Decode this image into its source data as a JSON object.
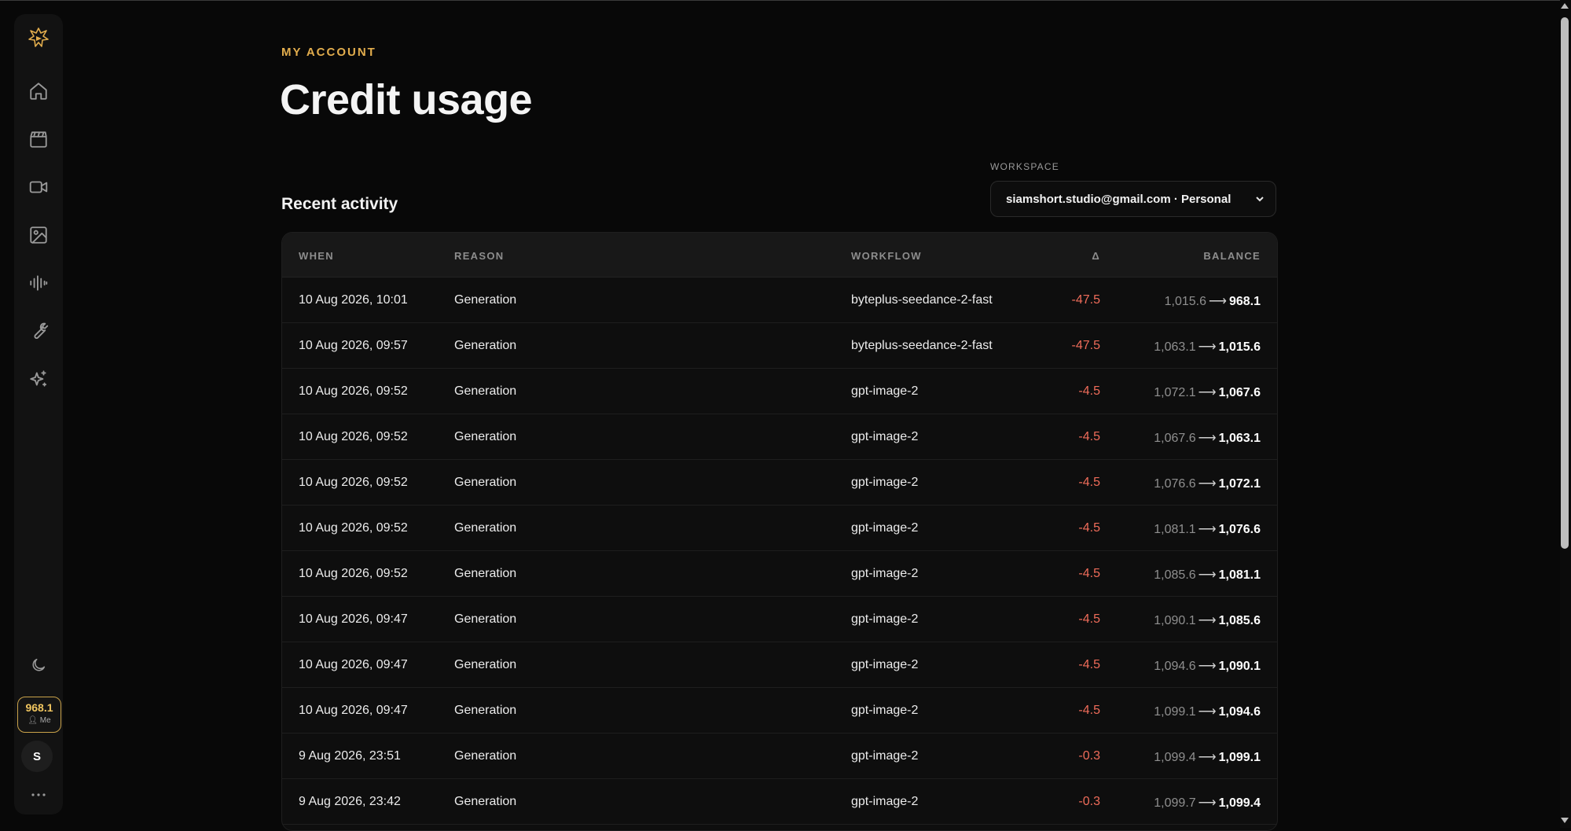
{
  "sidebar": {
    "items": [
      {
        "icon": "home-icon"
      },
      {
        "icon": "clapperboard-icon"
      },
      {
        "icon": "video-camera-icon"
      },
      {
        "icon": "image-icon"
      },
      {
        "icon": "audio-waveform-icon"
      },
      {
        "icon": "wrench-icon"
      },
      {
        "icon": "sparkles-icon"
      }
    ],
    "theme_icon": "moon-icon",
    "credits": {
      "value": "968.1",
      "owner": "Me"
    },
    "avatar_initial": "S",
    "more_icon": "more-dots-icon"
  },
  "header": {
    "eyebrow": "MY ACCOUNT",
    "title": "Credit usage"
  },
  "section": {
    "title": "Recent activity"
  },
  "workspace": {
    "label": "WORKSPACE",
    "selected": "siamshort.studio@gmail.com · Personal"
  },
  "table": {
    "columns": {
      "when": "WHEN",
      "reason": "REASON",
      "workflow": "WORKFLOW",
      "delta": "Δ",
      "balance": "BALANCE"
    },
    "rows": [
      {
        "when": "10 Aug 2026, 10:01",
        "reason": "Generation",
        "workflow": "byteplus-seedance-2-fast",
        "delta": "-47.5",
        "from": "1,015.6",
        "to": "968.1"
      },
      {
        "when": "10 Aug 2026, 09:57",
        "reason": "Generation",
        "workflow": "byteplus-seedance-2-fast",
        "delta": "-47.5",
        "from": "1,063.1",
        "to": "1,015.6"
      },
      {
        "when": "10 Aug 2026, 09:52",
        "reason": "Generation",
        "workflow": "gpt-image-2",
        "delta": "-4.5",
        "from": "1,072.1",
        "to": "1,067.6"
      },
      {
        "when": "10 Aug 2026, 09:52",
        "reason": "Generation",
        "workflow": "gpt-image-2",
        "delta": "-4.5",
        "from": "1,067.6",
        "to": "1,063.1"
      },
      {
        "when": "10 Aug 2026, 09:52",
        "reason": "Generation",
        "workflow": "gpt-image-2",
        "delta": "-4.5",
        "from": "1,076.6",
        "to": "1,072.1"
      },
      {
        "when": "10 Aug 2026, 09:52",
        "reason": "Generation",
        "workflow": "gpt-image-2",
        "delta": "-4.5",
        "from": "1,081.1",
        "to": "1,076.6"
      },
      {
        "when": "10 Aug 2026, 09:52",
        "reason": "Generation",
        "workflow": "gpt-image-2",
        "delta": "-4.5",
        "from": "1,085.6",
        "to": "1,081.1"
      },
      {
        "when": "10 Aug 2026, 09:47",
        "reason": "Generation",
        "workflow": "gpt-image-2",
        "delta": "-4.5",
        "from": "1,090.1",
        "to": "1,085.6"
      },
      {
        "when": "10 Aug 2026, 09:47",
        "reason": "Generation",
        "workflow": "gpt-image-2",
        "delta": "-4.5",
        "from": "1,094.6",
        "to": "1,090.1"
      },
      {
        "when": "10 Aug 2026, 09:47",
        "reason": "Generation",
        "workflow": "gpt-image-2",
        "delta": "-4.5",
        "from": "1,099.1",
        "to": "1,094.6"
      },
      {
        "when": "9 Aug 2026, 23:51",
        "reason": "Generation",
        "workflow": "gpt-image-2",
        "delta": "-0.3",
        "from": "1,099.4",
        "to": "1,099.1"
      },
      {
        "when": "9 Aug 2026, 23:42",
        "reason": "Generation",
        "workflow": "gpt-image-2",
        "delta": "-0.3",
        "from": "1,099.7",
        "to": "1,099.4"
      }
    ],
    "balance_arrow": "⟶"
  },
  "colors": {
    "accent": "#e2ad4d",
    "negative": "#ef6c5a",
    "background": "#080808"
  }
}
